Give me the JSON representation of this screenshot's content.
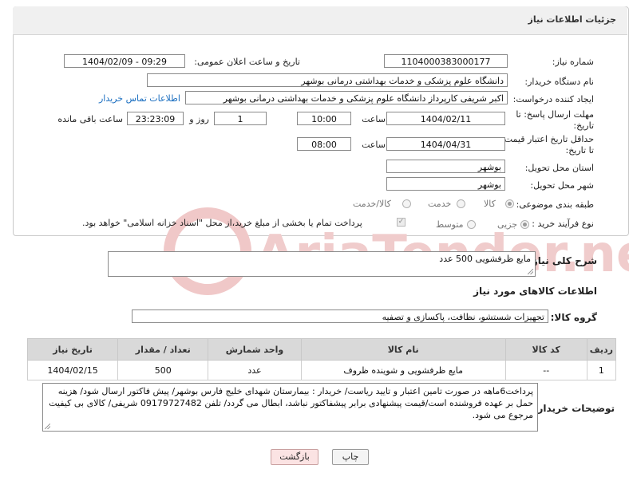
{
  "header": {
    "title": "جزئیات اطلاعات نیاز"
  },
  "form": {
    "need_number": {
      "label": "شماره نیاز:",
      "value": "1104000383000177"
    },
    "announce_datetime": {
      "label": "تاریخ و ساعت اعلان عمومی:",
      "value": "1404/02/09 - 09:29"
    },
    "buyer_org": {
      "label": "نام دستگاه خریدار:",
      "value": "دانشگاه علوم پزشکی و خدمات بهداشتی درمانی بوشهر"
    },
    "requester": {
      "label": "ایجاد کننده درخواست:",
      "value": "اکبر شریفی کارپرداز دانشگاه علوم پزشکی و خدمات بهداشتی درمانی بوشهر",
      "contact_link": "اطلاعات تماس خریدار"
    },
    "reply_deadline": {
      "label_line1": "مهلت ارسال پاسخ: تا",
      "label_line2": "تاریخ:",
      "date": "1404/02/11",
      "time_label": "ساعت",
      "time": "10:00",
      "days": "1",
      "days_label": "روز و",
      "remaining": "23:23:09",
      "remaining_label": "ساعت باقی مانده"
    },
    "price_validity": {
      "label_line1": "حداقل تاریخ اعتبار قیمت:",
      "label_line2": "تا تاریخ:",
      "date": "1404/04/31",
      "time_label": "ساعت",
      "time": "08:00"
    },
    "province": {
      "label": "استان محل تحویل:",
      "value": "بوشهر"
    },
    "city": {
      "label": "شهر محل تحویل:",
      "value": "بوشهر"
    },
    "category": {
      "label": "طبقه بندی موضوعی:",
      "options": [
        "کالا",
        "خدمت",
        "کالا/خدمت"
      ],
      "selected": "کالا"
    },
    "purchase_type": {
      "label": "نوع فرآیند خرید :",
      "options": [
        "جزیی",
        "متوسط"
      ],
      "selected": "جزیی",
      "note": "پرداخت تمام یا بخشی از مبلغ خرید،از محل \"اسناد خزانه اسلامی\" خواهد بود."
    }
  },
  "description": {
    "label": "شرح کلی نیاز:",
    "value": "مایع ظرفشویی 500 عدد"
  },
  "goods_section": {
    "title": "اطلاعات کالاهای مورد نیاز"
  },
  "goods_group": {
    "label": "گروه کالا:",
    "value": "تجهیزات شستشو، نظافت، پاکسازی و تصفیه"
  },
  "items_table": {
    "headers": [
      "ردیف",
      "کد کالا",
      "نام کالا",
      "واحد شمارش",
      "تعداد / مقدار",
      "تاریخ نیاز"
    ],
    "rows": [
      [
        "1",
        "--",
        "مایع ظرفشویی و شوینده ظروف",
        "عدد",
        "500",
        "1404/02/15"
      ]
    ]
  },
  "buyer_notes": {
    "label": "توضیحات خریدار:",
    "value": "پرداخت6ماهه در صورت تامین اعتبار و تایید ریاست/ خریدار : بیمارستان شهدای خلیج فارس بوشهر/ پیش فاکتور ارسال شود/ هزینه حمل بر عهده فروشنده است/قیمت پیشنهادی برابر پیشفاکتور نباشد، ابطال می گردد/ تلفن 09179727482 شریفی/ کالای بی کیفیت مرجوع می شود."
  },
  "buttons": {
    "print": "چاپ",
    "back": "بازگشت"
  },
  "watermark": {
    "text": "AriaTender.neT",
    "color": "#e8b4b4"
  }
}
